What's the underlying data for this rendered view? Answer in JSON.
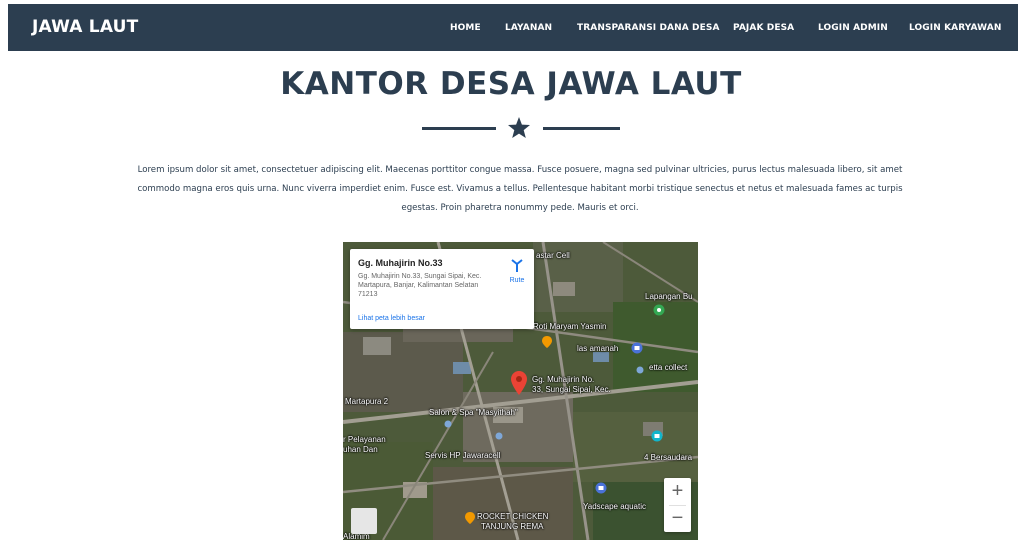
{
  "navbar": {
    "brand": "JAWA LAUT",
    "items": [
      "HOME",
      "LAYANAN",
      "TRANSPARANSI DANA DESA",
      "PAJAK DESA",
      "LOGIN ADMIN",
      "LOGIN KARYAWAN"
    ],
    "background": "#2c3e50"
  },
  "page": {
    "title": "KANTOR DESA JAWA LAUT",
    "intro": "Lorem ipsum dolor sit amet, consectetuer adipiscing elit. Maecenas porttitor congue massa. Fusce posuere, magna sed pulvinar ultricies, purus lectus malesuada libero, sit amet commodo magna eros quis urna. Nunc viverra imperdiet enim. Fusce est. Vivamus a tellus. Pellentesque habitant morbi tristique senectus et netus et malesuada fames ac turpis egestas. Proin pharetra nonummy pede. Mauris et orci.",
    "accent": "#2c3e50"
  },
  "map": {
    "info_title": "Gg. Muhajirin No.33",
    "info_address": "Gg. Muhajirin No.33, Sungai Sipai, Kec. Martapura, Banjar, Kalimantan Selatan 71213",
    "route_label": "Rute",
    "larger_map_link": "Lihat peta lebih besar",
    "zoom_in": "+",
    "zoom_out": "−",
    "labels": {
      "astar_cell": "astar Cell",
      "lapangan": "Lapangan Bu",
      "roti": "Roti Maryam Yasmin",
      "las": "las amanah",
      "etta": "etta collect",
      "pin_line1": "Gg. Muhajirin No.",
      "pin_line2": "33, Sungai Sipai, Kec.",
      "martapura": "Martapura 2",
      "salon": "Salon & Spa \"Masyithah\"",
      "pelayanan1": "r Pelayanan",
      "pelayanan2": "uhan Dan",
      "servis": "Servis HP Jawaracell",
      "bersaudara": "4 Bersaudara",
      "yadscape": "Yadscape aquatic",
      "rocket1": "ROCKET CHICKEN",
      "rocket2": "TANJUNG REMA",
      "alamim": "Alamim"
    }
  }
}
